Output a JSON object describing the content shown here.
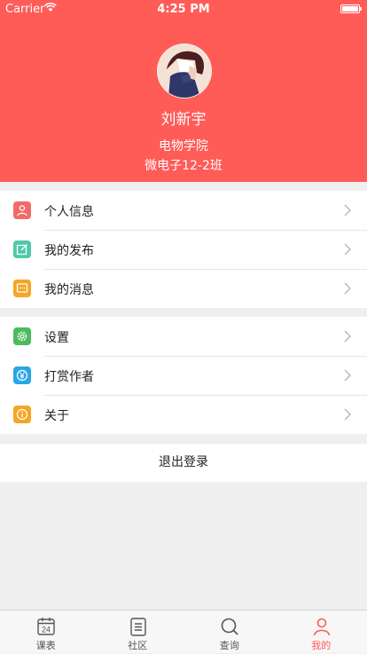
{
  "status_bar": {
    "carrier": "Carrier",
    "time": "4:25 PM"
  },
  "profile": {
    "name": "刘新宇",
    "college": "电物学院",
    "class": "微电子12-2班"
  },
  "menu_group_1": [
    {
      "label": "个人信息",
      "icon": "user-icon",
      "color": "#f36a6a"
    },
    {
      "label": "我的发布",
      "icon": "edit-icon",
      "color": "#4fc9a8"
    },
    {
      "label": "我的消息",
      "icon": "message-icon",
      "color": "#f5a623"
    }
  ],
  "menu_group_2": [
    {
      "label": "设置",
      "icon": "gear-icon",
      "color": "#4cbb5c"
    },
    {
      "label": "打赏作者",
      "icon": "yen-icon",
      "color": "#29a6e6"
    },
    {
      "label": "关于",
      "icon": "info-icon",
      "color": "#f5a623"
    }
  ],
  "logout": {
    "label": "退出登录"
  },
  "tabbar": [
    {
      "label": "课表",
      "icon": "calendar-icon",
      "calendar_day": "24",
      "active": false
    },
    {
      "label": "社区",
      "icon": "list-icon",
      "active": false
    },
    {
      "label": "查询",
      "icon": "search-icon",
      "active": false
    },
    {
      "label": "我的",
      "icon": "person-icon",
      "active": true
    }
  ],
  "colors": {
    "accent": "#ff5b57",
    "background": "#efefef"
  }
}
